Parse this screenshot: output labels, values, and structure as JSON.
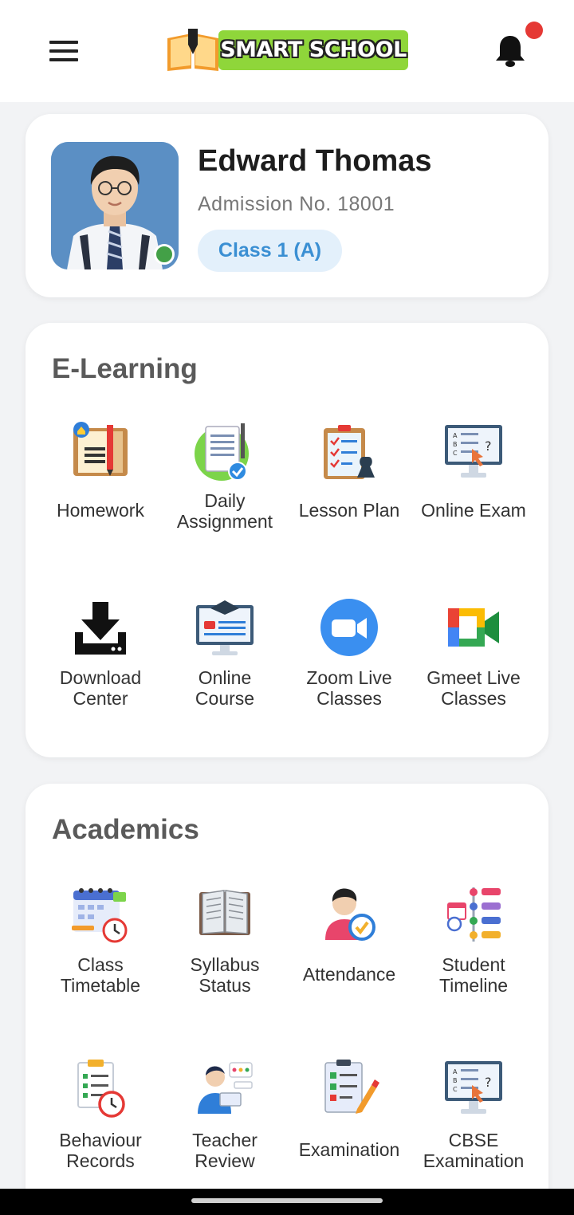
{
  "header": {
    "app_name": "SMART SCHOOL",
    "menu_icon": "hamburger-menu-icon",
    "notification_icon": "bell-icon",
    "notification_dot_color": "#e53935"
  },
  "profile": {
    "name": "Edward Thomas",
    "admission": "Admission No. 18001",
    "class_label": "Class 1 (A)",
    "online_status_color": "#43a047"
  },
  "elearning": {
    "title": "E-Learning",
    "items": [
      {
        "label": "Homework",
        "icon": "homework-icon"
      },
      {
        "label": "Daily\nAssignment",
        "icon": "daily-assignment-icon"
      },
      {
        "label": "Lesson Plan",
        "icon": "lesson-plan-icon"
      },
      {
        "label": "Online Exam",
        "icon": "online-exam-icon"
      },
      {
        "label": "Download\nCenter",
        "icon": "download-icon"
      },
      {
        "label": "Online\nCourse",
        "icon": "online-course-icon"
      },
      {
        "label": "Zoom Live\nClasses",
        "icon": "zoom-icon"
      },
      {
        "label": "Gmeet Live\nClasses",
        "icon": "gmeet-icon"
      }
    ]
  },
  "academics": {
    "title": "Academics",
    "items": [
      {
        "label": "Class\nTimetable",
        "icon": "timetable-icon"
      },
      {
        "label": "Syllabus\nStatus",
        "icon": "syllabus-book-icon"
      },
      {
        "label": "Attendance",
        "icon": "attendance-icon"
      },
      {
        "label": "Student\nTimeline",
        "icon": "timeline-icon"
      },
      {
        "label": "Behaviour\nRecords",
        "icon": "behaviour-records-icon"
      },
      {
        "label": "Teacher\nReview",
        "icon": "teacher-review-icon"
      },
      {
        "label": "Examination",
        "icon": "examination-icon"
      },
      {
        "label": "CBSE\nExamination",
        "icon": "cbse-exam-icon"
      }
    ]
  }
}
